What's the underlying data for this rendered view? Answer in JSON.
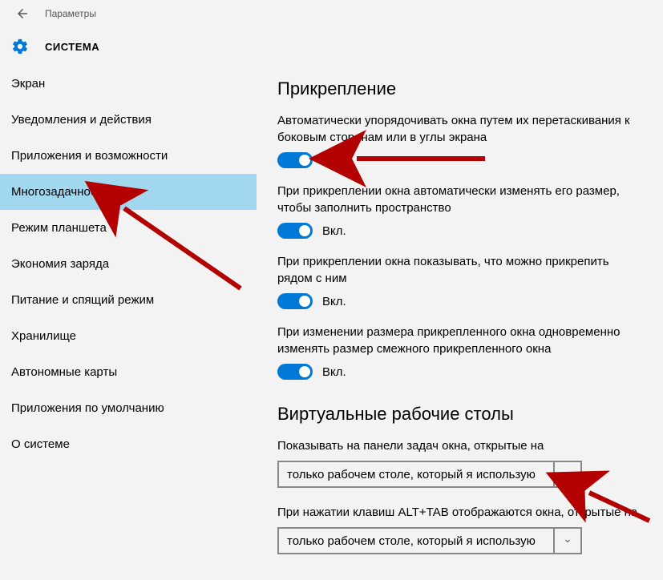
{
  "titlebar": {
    "title": "Параметры"
  },
  "header": {
    "title": "СИСТЕМА"
  },
  "sidebar": {
    "items": [
      {
        "label": "Экран"
      },
      {
        "label": "Уведомления и действия"
      },
      {
        "label": "Приложения и возможности"
      },
      {
        "label": "Многозадачность",
        "selected": true
      },
      {
        "label": "Режим планшета"
      },
      {
        "label": "Экономия заряда"
      },
      {
        "label": "Питание и спящий режим"
      },
      {
        "label": "Хранилище"
      },
      {
        "label": "Автономные карты"
      },
      {
        "label": "Приложения по умолчанию"
      },
      {
        "label": "О системе"
      }
    ]
  },
  "snap": {
    "title": "Прикрепление",
    "opt1": "Автоматически упорядочивать окна путем их перетаскивания к боковым сторонам или в углы экрана",
    "opt2": "При прикреплении окна автоматически изменять его размер, чтобы заполнить пространство",
    "opt3": "При прикреплении окна показывать, что можно прикрепить рядом с ним",
    "opt4": "При изменении размера прикрепленного окна одновременно изменять размер смежного прикрепленного окна",
    "on": "Вкл."
  },
  "vdesk": {
    "title": "Виртуальные рабочие столы",
    "label1": "Показывать на панели задач окна, открытые на",
    "select1": "только рабочем столе, который я использую",
    "label2": "При нажатии клавиш ALT+TAB отображаются окна, открытые на",
    "select2": "только рабочем столе, который я использую"
  }
}
